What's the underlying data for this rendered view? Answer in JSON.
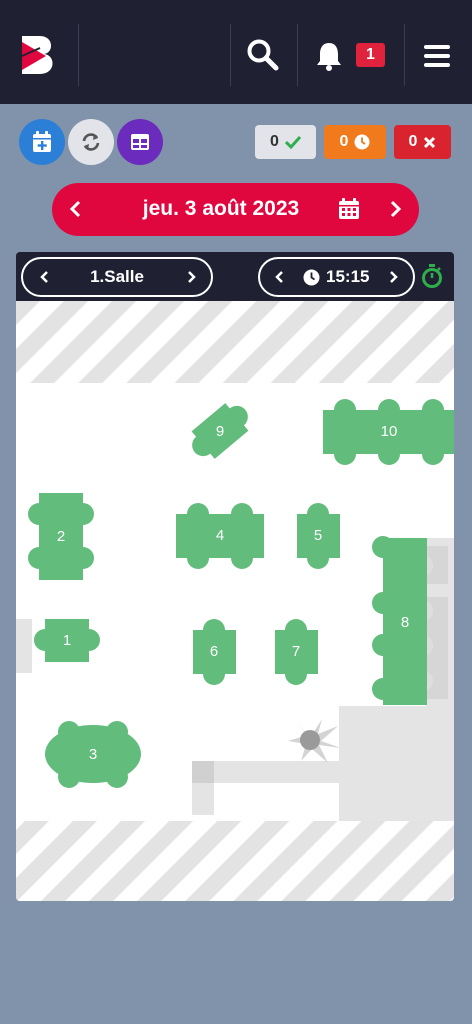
{
  "header": {
    "notification_count": "1",
    "icons": {
      "logo": "app-logo",
      "search": "search-icon",
      "bell": "bell-icon",
      "menu": "hamburger-menu-icon"
    }
  },
  "actions": {
    "add_reservation_icon": "calendar-plus-icon",
    "refresh_icon": "refresh-icon",
    "floorplan_icon": "table-layout-icon"
  },
  "status_counts": {
    "confirmed": "0",
    "pending": "0",
    "cancelled": "0"
  },
  "colors": {
    "topbar": "#1f2133",
    "background": "#8093ab",
    "date_bar": "#e0073e",
    "table": "#62bc7c",
    "confirmed_check": "#2fae4b",
    "pending": "#f07a1c",
    "cancelled": "#d9242f"
  },
  "date_nav": {
    "date": "jeu. 3 août 2023"
  },
  "floor": {
    "room_name": "1.Salle",
    "time": "15:15",
    "tables": [
      {
        "label": "1"
      },
      {
        "label": "2"
      },
      {
        "label": "3"
      },
      {
        "label": "4"
      },
      {
        "label": "5"
      },
      {
        "label": "6"
      },
      {
        "label": "7"
      },
      {
        "label": "8"
      },
      {
        "label": "9"
      },
      {
        "label": "10"
      }
    ]
  }
}
